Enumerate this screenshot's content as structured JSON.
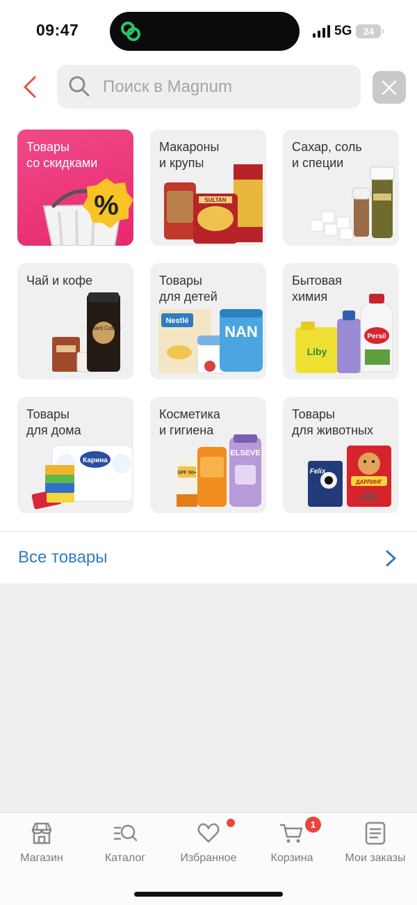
{
  "status_bar": {
    "time": "09:47",
    "network": "5G",
    "battery": "24"
  },
  "search": {
    "placeholder": "Поиск в Magnum"
  },
  "categories": [
    {
      "title": "Товары\nсо скидками",
      "icon": "discount-basket-image"
    },
    {
      "title": "Макароны\nи крупы",
      "icon": "pasta-grains-image"
    },
    {
      "title": "Сахар, соль\nи специи",
      "icon": "sugar-salt-spices-image"
    },
    {
      "title": "Чай и кофе",
      "icon": "tea-coffee-image"
    },
    {
      "title": "Товары\nдля детей",
      "icon": "baby-food-image"
    },
    {
      "title": "Бытовая\nхимия",
      "icon": "household-chemicals-image"
    },
    {
      "title": "Товары\nдля дома",
      "icon": "home-goods-image"
    },
    {
      "title": "Косметика\nи гигиена",
      "icon": "cosmetics-image"
    },
    {
      "title": "Товары\nдля животных",
      "icon": "pet-food-image"
    }
  ],
  "product_labels": {
    "percent": "%",
    "sultan": "SULTAN",
    "coffee": "Instant Coffee",
    "nestle": "Nestlé",
    "nan": "NAN",
    "liby": "Liby",
    "persil": "Persil",
    "karina": "Карина",
    "spf": "SPF 50+",
    "elseve": "ELSEVE",
    "felix": "Felix",
    "darling": "ДАРЛИНГ"
  },
  "all_goods": {
    "label": "Все товары"
  },
  "tabs": [
    {
      "label": "Магазин",
      "icon": "store-icon"
    },
    {
      "label": "Каталог",
      "icon": "catalog-search-icon"
    },
    {
      "label": "Избранное",
      "icon": "heart-icon"
    },
    {
      "label": "Корзина",
      "icon": "cart-icon"
    },
    {
      "label": "Мои заказы",
      "icon": "orders-icon"
    }
  ],
  "cart_badge": "1",
  "colors": {
    "accent_blue": "#2f7dc0",
    "promo_pink": "#e8286f",
    "badge_red": "#e8473c",
    "back_arrow": "#e0533f"
  }
}
